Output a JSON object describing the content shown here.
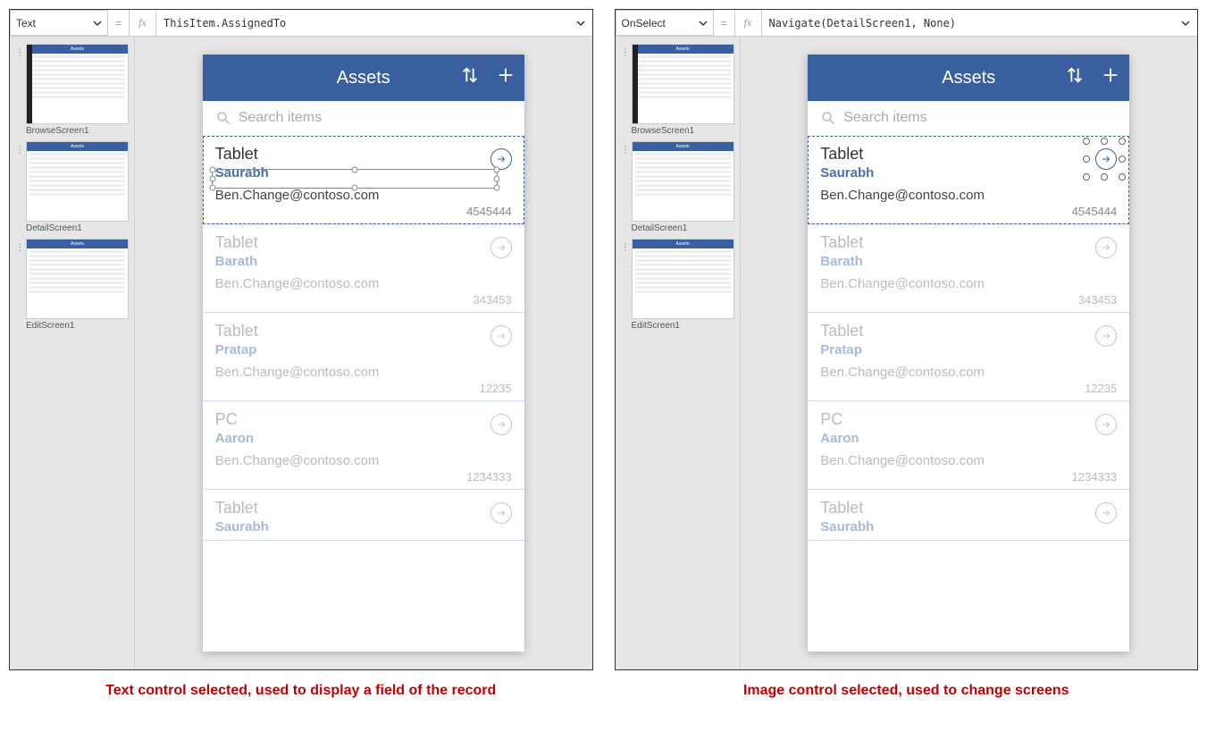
{
  "panels": [
    {
      "property": "Text",
      "formula": "ThisItem.AssignedTo",
      "caption": "Text control selected, used to display a field of the record",
      "selection_mode": "text"
    },
    {
      "property": "OnSelect",
      "formula": "Navigate(DetailScreen1, None)",
      "caption": "Image control selected, used to change screens",
      "selection_mode": "image"
    }
  ],
  "app_header_title": "Assets",
  "search_placeholder": "Search items",
  "thumbs": [
    {
      "label": "BrowseScreen1"
    },
    {
      "label": "DetailScreen1"
    },
    {
      "label": "EditScreen1"
    }
  ],
  "items": [
    {
      "title": "Tablet",
      "assigned": "Saurabh",
      "email": "Ben.Change@contoso.com",
      "num": "4545444",
      "selected": true
    },
    {
      "title": "Tablet",
      "assigned": "Barath",
      "email": "Ben.Change@contoso.com",
      "num": "343453",
      "selected": false
    },
    {
      "title": "Tablet",
      "assigned": "Pratap",
      "email": "Ben.Change@contoso.com",
      "num": "12235",
      "selected": false
    },
    {
      "title": "PC",
      "assigned": "Aaron",
      "email": "Ben.Change@contoso.com",
      "num": "1234333",
      "selected": false
    },
    {
      "title": "Tablet",
      "assigned": "Saurabh",
      "email": "",
      "num": "",
      "selected": false
    }
  ],
  "fx_label": "fx",
  "equals": "="
}
